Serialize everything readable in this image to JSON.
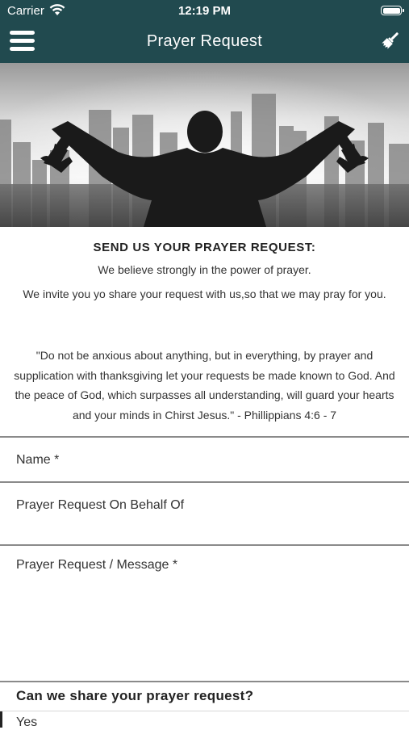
{
  "status_bar": {
    "carrier": "Carrier",
    "time": "12:19 PM",
    "wifi_icon": "wifi-icon",
    "battery_icon": "battery-icon"
  },
  "nav": {
    "title": "Prayer Request",
    "menu_icon": "hamburger-menu-icon",
    "action_icon": "paintbrush-icon"
  },
  "hero": {
    "image": "silhouette of a man with raised arms in front of a city skyline"
  },
  "intro": {
    "heading": "SEND US YOUR PRAYER REQUEST:",
    "line1": "We believe strongly in the power of prayer.",
    "line2": "We invite you yo share your request with us,so that we may pray for you.",
    "quote": "\"Do not be anxious about anything, but in everything, by prayer and supplication with thanksgiving let your requests be made known to God. And the peace of God, which surpasses all understanding, will guard your hearts and your minds in Chirst Jesus.\" - Phillippians 4:6 - 7"
  },
  "form": {
    "name_label": "Name *",
    "on_behalf_label": "Prayer Request On Behalf Of",
    "message_label": "Prayer Request / Message *",
    "share_question": "Can we share your prayer request?",
    "share_answer": "Yes"
  },
  "colors": {
    "nav_bar": "#214a4f",
    "divider": "#8a8a8a"
  }
}
